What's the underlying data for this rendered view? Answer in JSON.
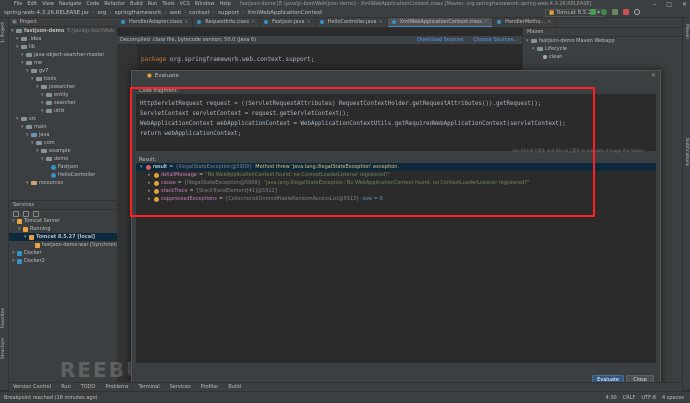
{
  "window": {
    "project_name": "spring-web-4.3.26.RELEASE.jar",
    "title": "fastjson-demo [E:\\java\\jc-bontWeb\\json-demo] - XmlWebApplicationContext.class [Maven: org.springframework:spring-web:4.3.26.RELEASE]",
    "menu": [
      "File",
      "Edit",
      "View",
      "Navigate",
      "Code",
      "Refactor",
      "Build",
      "Run",
      "Tools",
      "VCS",
      "Window",
      "Help"
    ]
  },
  "navbar": {
    "crumbs": [
      "spring-web-4.3.26.RELEASE.jar",
      "org",
      "springframework",
      "web",
      "context",
      "support",
      "XmlWebApplicationContext"
    ],
    "run_config": "Tomcat 8.5.27"
  },
  "project_panel": {
    "header": "Project",
    "items": [
      {
        "label": "fastjson-demo",
        "suffix": "E:\\java\\jc-bontWeb",
        "level": 0,
        "kind": "folder"
      },
      {
        "label": ".idea",
        "level": 1,
        "kind": "folder"
      },
      {
        "label": "lib",
        "level": 1,
        "kind": "folder"
      },
      {
        "label": "java-object-searcher-master",
        "level": 2,
        "kind": "folder"
      },
      {
        "label": "me",
        "level": 2,
        "kind": "folder"
      },
      {
        "label": "gv7",
        "level": 3,
        "kind": "folder"
      },
      {
        "label": "tools",
        "level": 4,
        "kind": "folder"
      },
      {
        "label": "josearcher",
        "level": 5,
        "kind": "folder"
      },
      {
        "label": "entity",
        "level": 6,
        "kind": "folder"
      },
      {
        "label": "searcher",
        "level": 6,
        "kind": "folder"
      },
      {
        "label": "utils",
        "level": 6,
        "kind": "folder"
      },
      {
        "label": "src",
        "level": 1,
        "kind": "folder"
      },
      {
        "label": "main",
        "level": 2,
        "kind": "folder"
      },
      {
        "label": "java",
        "level": 3,
        "kind": "folder-blue"
      },
      {
        "label": "com",
        "level": 4,
        "kind": "folder"
      },
      {
        "label": "example",
        "level": 5,
        "kind": "folder"
      },
      {
        "label": "demo",
        "level": 6,
        "kind": "folder"
      },
      {
        "label": "Fastjson",
        "level": 7,
        "kind": "class"
      },
      {
        "label": "HelloController",
        "level": 7,
        "kind": "class"
      },
      {
        "label": "resources",
        "level": 3,
        "kind": "folder-orange"
      }
    ]
  },
  "services_panel": {
    "header": "Services",
    "items": [
      {
        "label": "Tomcat Server",
        "level": 0,
        "selected": false
      },
      {
        "label": "Running",
        "level": 1,
        "selected": false
      },
      {
        "label": "Tomcat 8.5.27 [local]",
        "level": 2,
        "selected": true
      },
      {
        "label": "fastjson-demo:war [Synchronized]",
        "level": 3,
        "selected": false
      },
      {
        "label": "Docker",
        "level": 0,
        "selected": false
      },
      {
        "label": "Docker2",
        "level": 0,
        "selected": false
      }
    ]
  },
  "editor_tabs": [
    {
      "label": "HandlerAdapter.class",
      "active": false
    },
    {
      "label": "RequestInfo.class",
      "active": false
    },
    {
      "label": "Fastjson.java",
      "active": false
    },
    {
      "label": "HelloController.java",
      "active": false
    },
    {
      "label": "XmlWebApplicationContext.class",
      "active": true
    },
    {
      "label": "HandlerMetho...",
      "active": false
    }
  ],
  "maven_panel": {
    "header": "Maven",
    "items": [
      {
        "label": "fastjson-demo Maven Webapp",
        "level": 0
      },
      {
        "label": "Lifecycle",
        "level": 1
      },
      {
        "label": "clean",
        "level": 2
      }
    ]
  },
  "banner": {
    "text": "Decompiled .class file, bytecode version: 50.0 (Java 6)",
    "download_link": "Download Sources",
    "choose_link": "Choose Sources..."
  },
  "editor_code": "package org.springframework.web.context.support;",
  "dialog": {
    "title": "Evaluate",
    "code_label": "Code fragment:",
    "code_lines": [
      "HttpServletRequest request = ((ServletRequestAttributes) RequestContextHolder.getRequestAttributes()).getRequest();",
      "ServletContext servletContext = request.getServletContext();",
      "WebApplicationContext webApplicationContext = WebApplicationContextUtils.getRequiredWebApplicationContext(servletContext);",
      "return webApplicationContext;"
    ],
    "hint": "Use Alt+向下箭头 and Alt+向上箭头 to navigate through the history",
    "result_label": "Result:",
    "results": [
      {
        "name": "result",
        "ref": "{IllegalStateException@5909}",
        "value": "Method threw 'java.lang.IllegalStateException' exception.",
        "level": 0,
        "selected": true,
        "dot": "#d75f5f"
      },
      {
        "name": "detailMessage",
        "ref": "",
        "value": "\"No WebApplicationContext found: no ContextLoaderListener registered?\"",
        "level": 1,
        "selected": false,
        "dot": "#e0a23a"
      },
      {
        "name": "cause",
        "ref": "{IllegalStateException@5909}",
        "value": "\"java.lang.IllegalStateException: No WebApplicationContext found: no ContextLoaderListener registered?\"",
        "level": 1,
        "selected": false,
        "dot": "#e0a23a"
      },
      {
        "name": "stackTrace",
        "ref": "{StackTraceElement[41]@5912}",
        "value": "",
        "level": 1,
        "selected": false,
        "dot": "#e0a23a"
      },
      {
        "name": "suppressedExceptions",
        "ref": "{Collections$UnmodifiableRandomAccessList@5913}",
        "value": "size = 0",
        "level": 1,
        "selected": false,
        "dot": "#e0a23a"
      }
    ],
    "evaluate_button": "Evaluate",
    "close_button": "Close"
  },
  "left_strip_labels": [
    "1: Project",
    "Structure",
    "Favorites"
  ],
  "right_strip_labels": [
    "Maven",
    "Notifications"
  ],
  "bottom_tabs": [
    "Version Control",
    "Run",
    "TODO",
    "Problems",
    "Terminal",
    "Services",
    "Profiler",
    "Build"
  ],
  "status": {
    "text": "Breakpoint reached (18 minutes ago)",
    "position": "4:30",
    "encoding": "CRLF",
    "charset": "UTF-8",
    "indent": "4 spaces"
  },
  "watermark": "REEBUF",
  "colors": {
    "annotation_box": "#ff2020",
    "accent": "#365880"
  }
}
